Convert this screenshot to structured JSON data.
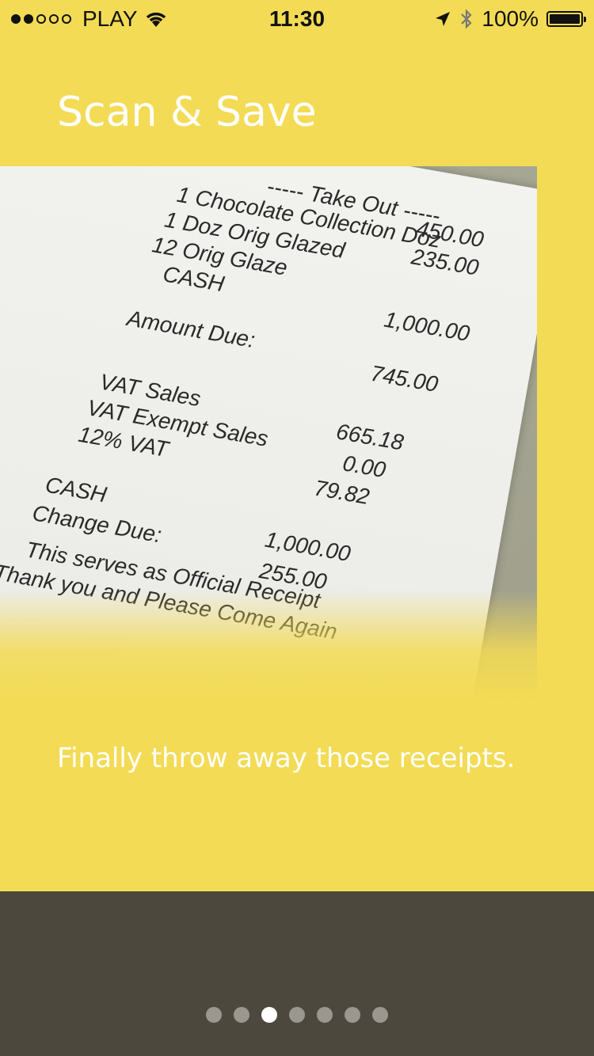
{
  "status_bar": {
    "carrier": "PLAY",
    "time": "11:30",
    "battery": "100%",
    "signal_bars_filled": 2,
    "signal_bars_total": 5
  },
  "onboarding": {
    "title": "Scan & Save",
    "caption": "Finally throw away those receipts.",
    "page_count": 7,
    "active_page": 3
  },
  "receipt": {
    "header": "----- Take Out -----",
    "lines": [
      "1  Chocolate Collection Doz",
      "1  Doz Orig Glazed",
      "12 Orig Glaze",
      "CASH",
      "Amount Due:",
      "VAT Sales",
      "VAT Exempt Sales",
      "12% VAT",
      "CASH",
      "Change Due:",
      "This serves as Official Receipt",
      "Thank you and Please Come Again"
    ],
    "amounts": [
      "450.00",
      "235.00",
      "1,000.00",
      "745.00",
      "665.18",
      "0.00",
      "79.82",
      "1,000.00",
      "255.00"
    ]
  },
  "colors": {
    "background": "#F3DB55",
    "bottom_bar": "#4C483E",
    "pager_active": "#FFFFFF",
    "pager_inactive": "#9A978F"
  }
}
